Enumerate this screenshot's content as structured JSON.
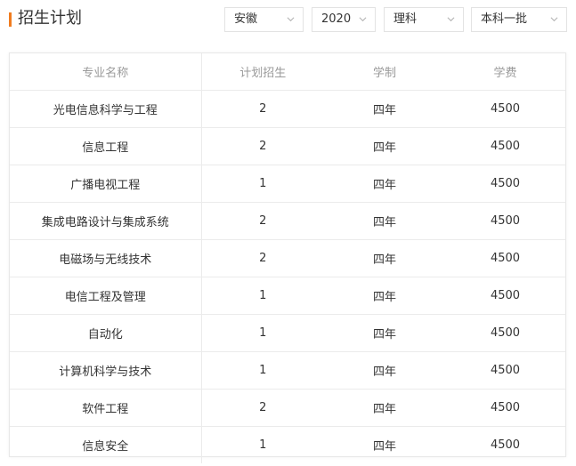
{
  "header": {
    "title": "招生计划",
    "accent_color": "#f07c1f"
  },
  "filters": {
    "province": "安徽",
    "year": "2020",
    "subject": "理科",
    "batch": "本科一批",
    "chevron_icon": "chevron-down-icon"
  },
  "table": {
    "headers": [
      "专业名称",
      "计划招生",
      "学制",
      "学费"
    ],
    "rows": [
      [
        "光电信息科学与工程",
        "2",
        "四年",
        "4500"
      ],
      [
        "信息工程",
        "2",
        "四年",
        "4500"
      ],
      [
        "广播电视工程",
        "1",
        "四年",
        "4500"
      ],
      [
        "集成电路设计与集成系统",
        "2",
        "四年",
        "4500"
      ],
      [
        "电磁场与无线技术",
        "2",
        "四年",
        "4500"
      ],
      [
        "电信工程及管理",
        "1",
        "四年",
        "4500"
      ],
      [
        "自动化",
        "1",
        "四年",
        "4500"
      ],
      [
        "计算机科学与技术",
        "1",
        "四年",
        "4500"
      ],
      [
        "软件工程",
        "2",
        "四年",
        "4500"
      ],
      [
        "信息安全",
        "1",
        "四年",
        "4500"
      ]
    ]
  }
}
